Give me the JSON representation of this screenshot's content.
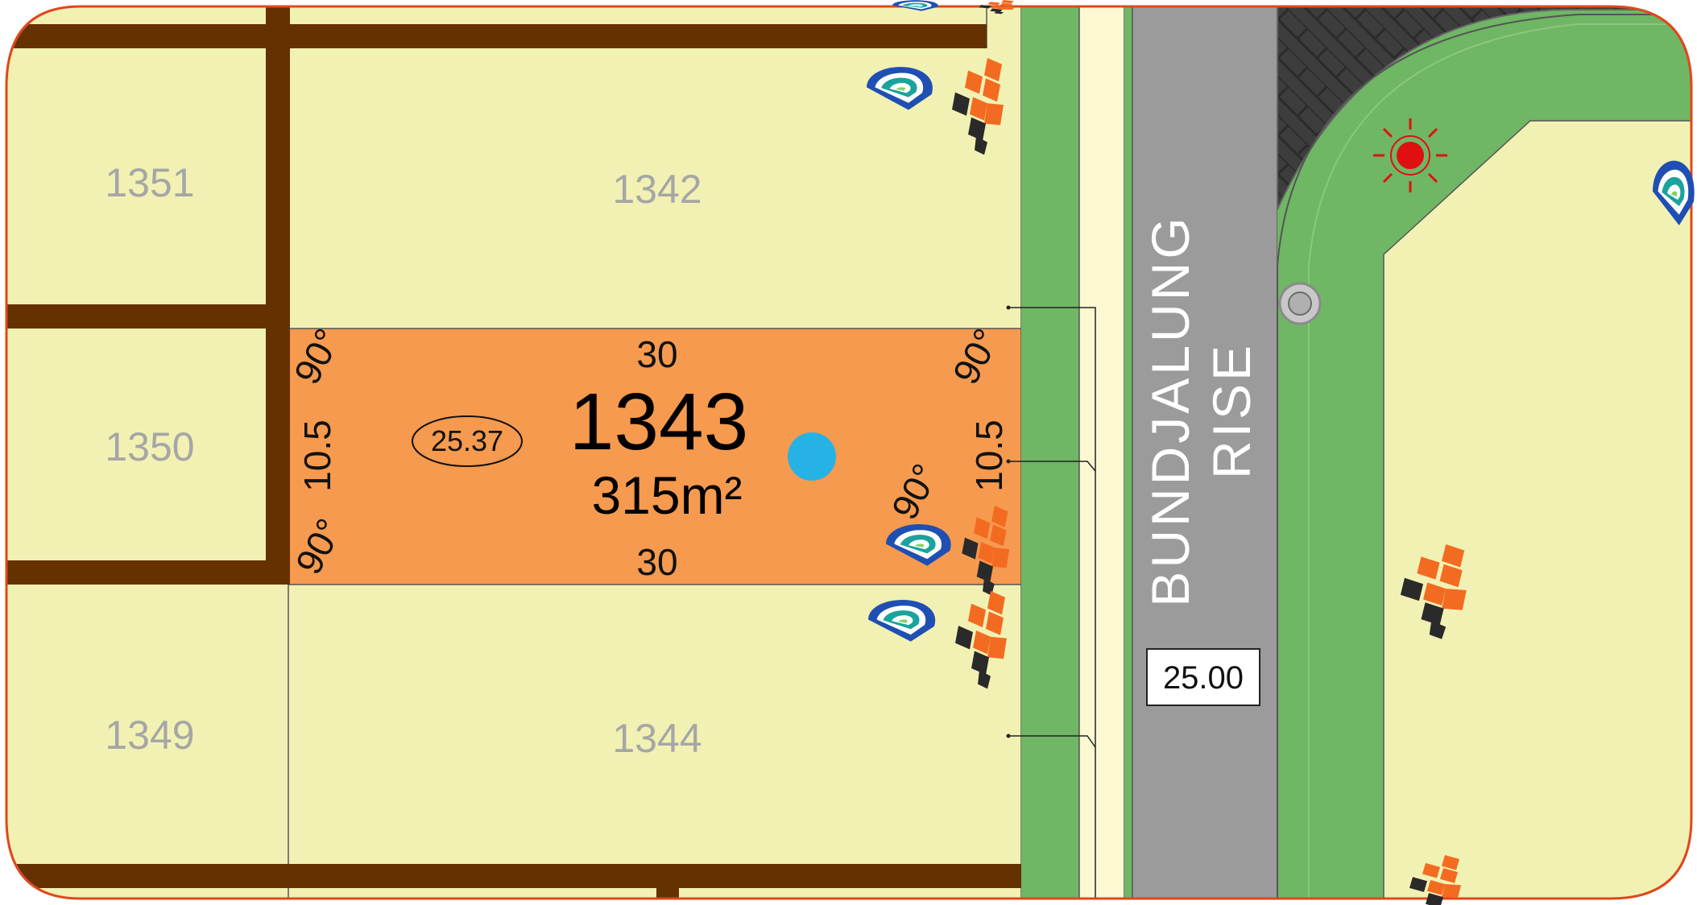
{
  "lots": {
    "l1351": "1351",
    "l1342": "1342",
    "l1350": "1350",
    "l1349": "1349",
    "l1344": "1344"
  },
  "featured_lot": {
    "number": "1343",
    "area": "315m²",
    "top_frontage": "30",
    "bottom_frontage": "30",
    "left_depth": "10.5",
    "right_depth": "10.5",
    "oval_label": "25.37",
    "angle": "90°"
  },
  "road": {
    "name_line1": "BUNDJALUNG",
    "name_line2": "RISE",
    "width_label": "25.00"
  },
  "colors": {
    "lot_fill": "#f2f1b4",
    "featured_fill": "#f59a4e",
    "retaining_wall": "#653100",
    "verge_green": "#6fb665",
    "road_grey": "#9b9b9b",
    "path_cream": "#fbf8d2",
    "driveway_dark": "#3f3f3f",
    "marker_cyan": "#27b2e6",
    "light_red": "#e01010",
    "logo_orange": "#f36b21",
    "logo_dark": "#2a2a2a",
    "logo_teal": "#1aa39c",
    "logo_blue": "#1f4fb3"
  },
  "icons": [
    "brand-logo-icon",
    "builder-logo-icon",
    "street-light-icon",
    "service-pit-icon",
    "lot-marker-icon"
  ]
}
